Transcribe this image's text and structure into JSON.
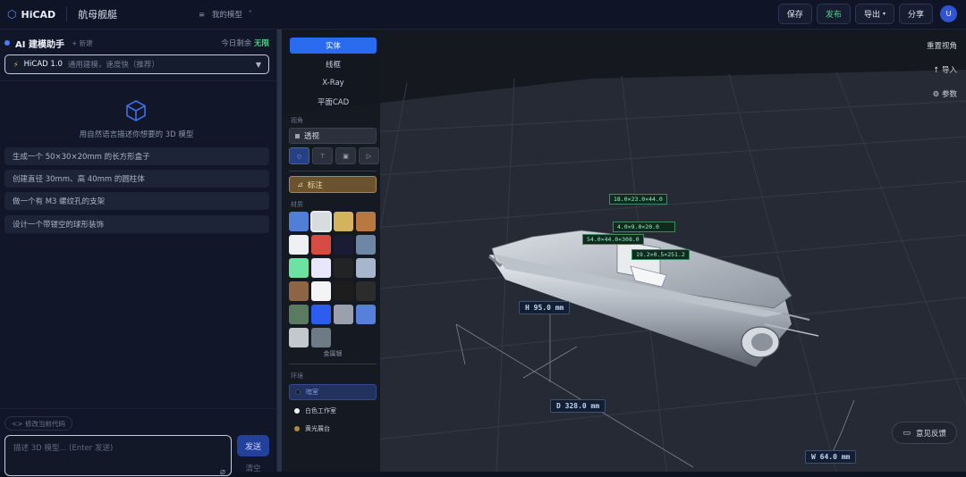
{
  "topbar": {
    "brand": "HiCAD",
    "project_name": "航母舰艇",
    "my_models": "我的模型",
    "buttons": {
      "save": "保存",
      "publish": "发布",
      "export": "导出",
      "share": "分享"
    },
    "avatar_initial": "U"
  },
  "assistant": {
    "title": "AI 建模助手",
    "new": "+ 新建",
    "quota_label": "今日剩余",
    "quota_value": "无限",
    "model_name": "HiCAD 1.0",
    "model_desc": "通用建模，速度快（推荐）",
    "hint": "用自然语言描述你想要的 3D 模型",
    "suggestions": [
      "生成一个 50×30×20mm 的长方形盒子",
      "创建直径 30mm、高 40mm 的圆柱体",
      "做一个有 M3 螺纹孔的支架",
      "设计一个带镂空的球形装饰"
    ],
    "modify_code": "<> 修改当前代码",
    "input_placeholder": "描述 3D 模型... (Enter 发送)",
    "send": "发送",
    "clear": "清空"
  },
  "render_modes": [
    "实体",
    "线框",
    "X-Ray",
    "平面CAD"
  ],
  "view_section": {
    "label": "视角",
    "projection": "透视",
    "view_icons": [
      "◇",
      "⊤",
      "▣",
      "▷"
    ]
  },
  "annotate": "标注",
  "material": {
    "label": "材质",
    "metal_label": "金属银",
    "colors": [
      "#4f7fd6",
      "#d9dcdf",
      "#d4b35d",
      "#b8783f",
      "#eef0f3",
      "#d64b43",
      "#1a1c33",
      "#6e87a6",
      "#6de3a2",
      "#e9e6fb",
      "#222324",
      "#a7b6cc",
      "#8d6545",
      "#f4f4f4",
      "#1d1d1d",
      "#2c2c2c",
      "#5a7a62",
      "#2d5cf0",
      "#9aa1ad",
      "#5680d9",
      "#c3c8cd",
      "#6e7a86"
    ],
    "selected_index": 1
  },
  "environment": {
    "label": "环境",
    "options": [
      {
        "name": "暗室",
        "dot": "#1a1f2e"
      },
      {
        "name": "白色工作室",
        "dot": "#f0f0f0"
      },
      {
        "name": "黄光展台",
        "dot": "#b38a3a"
      }
    ],
    "active_index": 0
  },
  "viewport_tools": [
    "重置视角",
    "导入",
    "参数"
  ],
  "feedback": "意见反馈",
  "dimensions": {
    "height": "H 95.0 mm",
    "depth": "D 328.0 mm",
    "width": "W 64.0 mm"
  },
  "part_tags": [
    "18.0×23.0×44.0",
    "4.0×9.0×20.0",
    "54.0×44.0×308.0",
    "19.2×0.5×251.2"
  ]
}
